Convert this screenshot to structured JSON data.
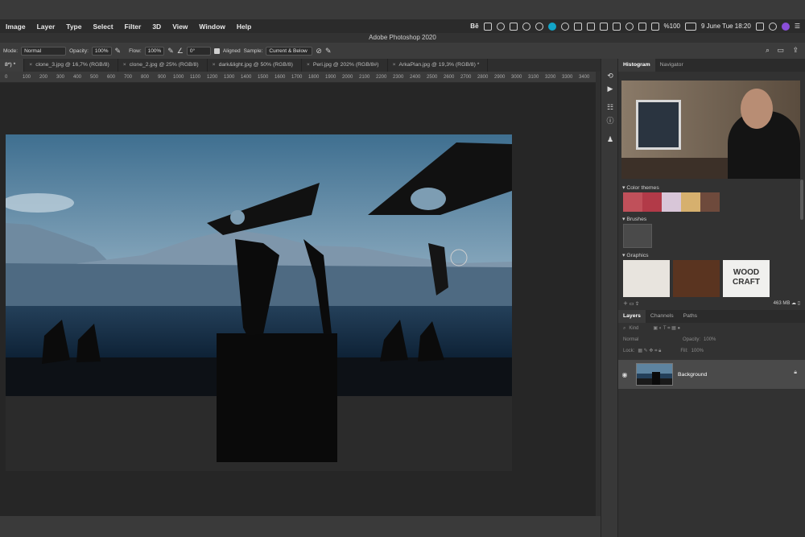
{
  "menubar": {
    "items": [
      "Image",
      "Layer",
      "Type",
      "Select",
      "Filter",
      "3D",
      "View",
      "Window",
      "Help"
    ],
    "right": {
      "behance": "Bē",
      "battery": "%100",
      "datetime": "9 June Tue  18:20"
    }
  },
  "app": {
    "title": "Adobe Photoshop 2020"
  },
  "options": {
    "mode_label": "Mode:",
    "mode_value": "Normal",
    "opacity_label": "Opacity:",
    "opacity_value": "100%",
    "flow_label": "Flow:",
    "flow_value": "100%",
    "angle_value": "0°",
    "aligned_label": "Aligned",
    "sample_label": "Sample:",
    "sample_value": "Current & Below"
  },
  "tabs": [
    {
      "label": "8*) *",
      "active": true
    },
    {
      "label": "clone_3.jpg @ 16,7% (RGB/8)"
    },
    {
      "label": "clone_2.jpg @ 25% (RGB/8)"
    },
    {
      "label": "dark&light.jpg @ 50% (RGB/8)"
    },
    {
      "label": "Peri.jpg @ 202% (RGB/8#)"
    },
    {
      "label": "ArkaPlan.jpg @ 19,3% (RGB/8) *"
    }
  ],
  "ruler": [
    "0",
    "100",
    "200",
    "300",
    "400",
    "500",
    "600",
    "700",
    "800",
    "900",
    "1000",
    "1100",
    "1200",
    "1300",
    "1400",
    "1500",
    "1600",
    "1700",
    "1800",
    "1900",
    "2000",
    "2100",
    "2200",
    "2300",
    "2400",
    "2500",
    "2600",
    "2700",
    "2800",
    "2900",
    "3000",
    "3100",
    "3200",
    "3300",
    "3400"
  ],
  "panels": {
    "top_tabs": [
      "Histogram",
      "Navigator"
    ],
    "color_themes_label": "Color themes",
    "color_themes": [
      "#c0505a",
      "#b23a48",
      "#d8c6d8",
      "#d6b06e",
      "#6e4a3c"
    ],
    "brushes_label": "Brushes",
    "graphics_label": "Graphics",
    "wood_line1": "WOOD",
    "wood_line2": "CRAFT",
    "storage": "463 MB",
    "layers_tabs": [
      "Layers",
      "Channels",
      "Paths"
    ],
    "kind_label": "Kind",
    "blend_mode": "Normal",
    "opacity_label": "Opacity:",
    "opacity_value": "100%",
    "lock_label": "Lock:",
    "fill_label": "Fill:",
    "fill_value": "100%",
    "layer_name": "Background"
  }
}
